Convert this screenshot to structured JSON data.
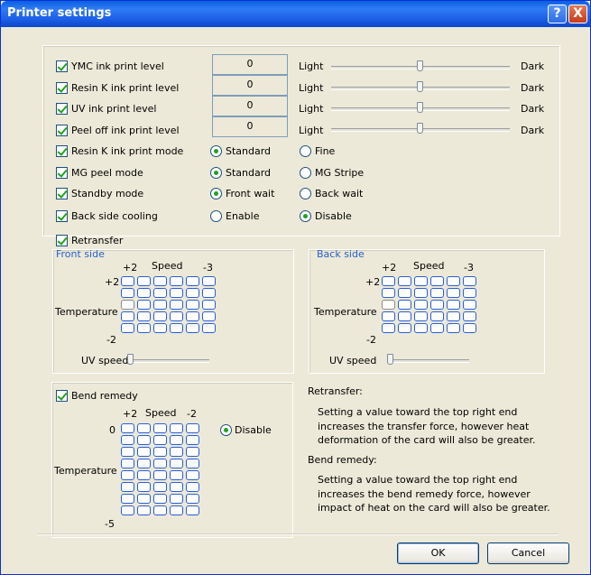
{
  "window": {
    "title": "Printer settings",
    "help_label": "?",
    "close_label": "X"
  },
  "settings": {
    "ymc": {
      "label": "YMC ink print level",
      "value": "0",
      "left": "Light",
      "right": "Dark",
      "level": 0.5
    },
    "resin": {
      "label": "Resin K ink print level",
      "value": "0",
      "left": "Light",
      "right": "Dark",
      "level": 0.5
    },
    "uv": {
      "label": "UV ink print level",
      "value": "0",
      "left": "Light",
      "right": "Dark",
      "level": 0.5
    },
    "peel": {
      "label": "Peel off ink print level",
      "value": "0",
      "left": "Light",
      "right": "Dark",
      "level": 0.5
    }
  },
  "modes": {
    "resin_mode": {
      "label": "Resin K ink print mode",
      "opt1": "Standard",
      "opt2": "Fine"
    },
    "mg_peel": {
      "label": "MG peel mode",
      "opt1": "Standard",
      "opt2": "MG Stripe"
    },
    "standby": {
      "label": "Standby mode",
      "opt1": "Front wait",
      "opt2": "Back wait"
    },
    "back_cooling": {
      "label": "Back side cooling",
      "opt1": "Enable",
      "opt2": "Disable"
    }
  },
  "retransfer": {
    "label": "Retransfer",
    "front": {
      "title": "Front side",
      "speed": "Speed",
      "speed_min": "+2",
      "speed_max": "-3",
      "temp_top": "+2",
      "temp_bottom": "-2",
      "temperature": "Temperature",
      "uv_speed": "UV speed"
    },
    "back": {
      "title": "Back side",
      "speed": "Speed",
      "speed_min": "+2",
      "speed_max": "-3",
      "temp_top": "+2",
      "temp_bottom": "-2",
      "temperature": "Temperature",
      "uv_speed": "UV speed"
    }
  },
  "bend": {
    "label": "Bend remedy",
    "speed": "Speed",
    "speed_min": "+2",
    "speed_max": "-2",
    "temp_top": "0",
    "temp_bottom": "-5",
    "temperature": "Temperature",
    "disable": "Disable"
  },
  "help": {
    "retransfer_title": "Retransfer:",
    "retransfer_text": [
      "Setting a value toward the top right end",
      "increases the transfer force, however heat",
      "deformation of the card will also be greater."
    ],
    "bend_title": "Bend remedy:",
    "bend_text": [
      "Setting a value toward the top right end",
      "increases the bend remedy force, however",
      "impact of heat on the card will also be greater."
    ]
  },
  "buttons": {
    "ok": "OK",
    "cancel": "Cancel"
  }
}
